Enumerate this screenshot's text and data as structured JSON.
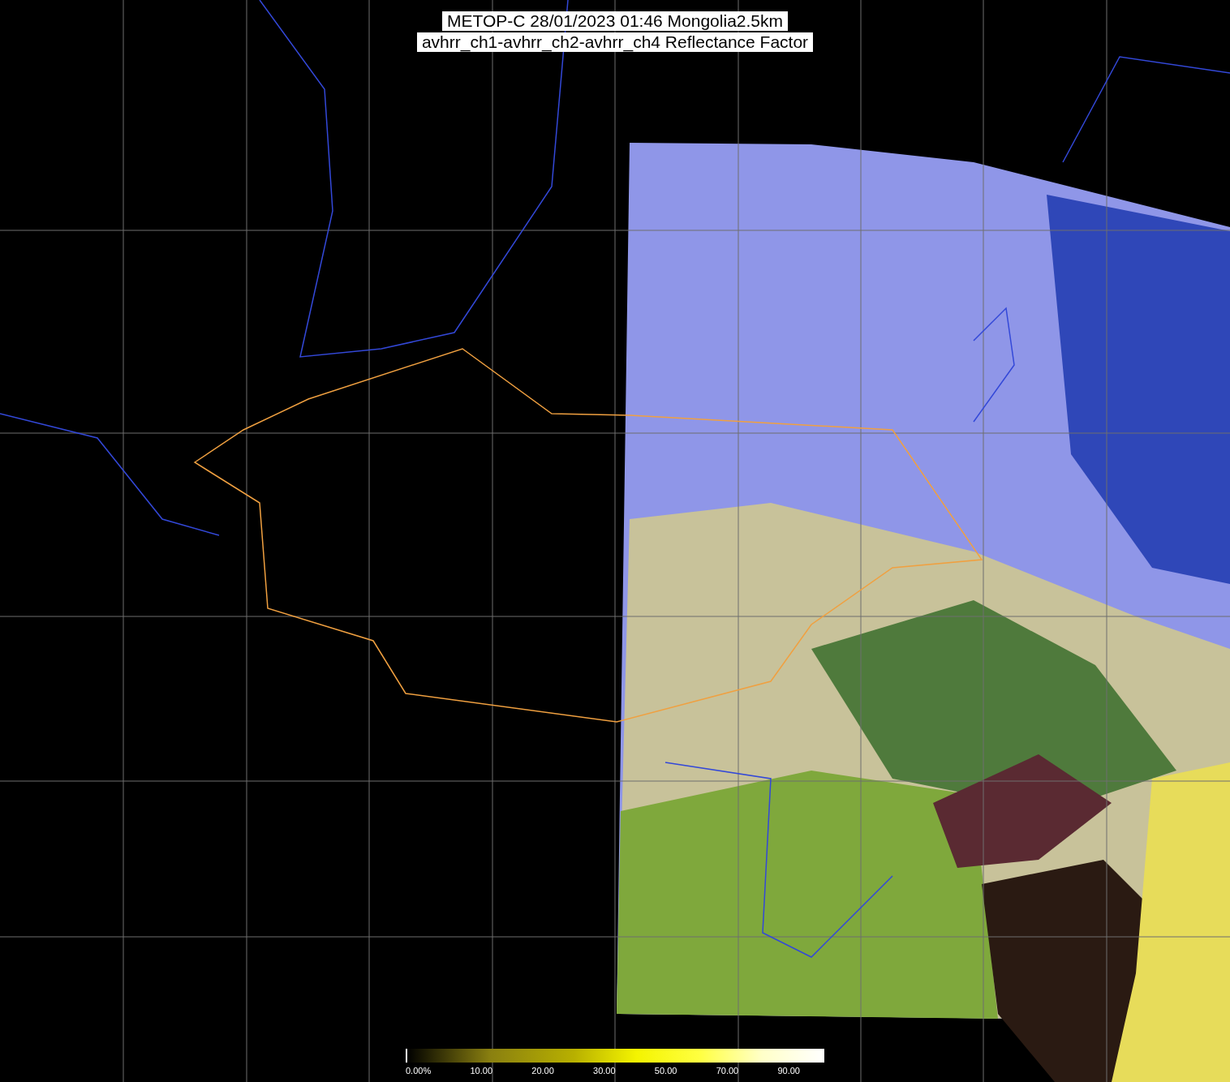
{
  "title_lines": [
    "METOP-C 28/01/2023 01:46 Mongolia2.5km",
    "avhrr_ch1-avhrr_ch2-avhrr_ch4 Reflectance Factor"
  ],
  "colorbar": {
    "labels": [
      "0.00%",
      "10.00",
      "20.00",
      "30.00",
      "50.00",
      "70.00",
      "90.00"
    ]
  }
}
